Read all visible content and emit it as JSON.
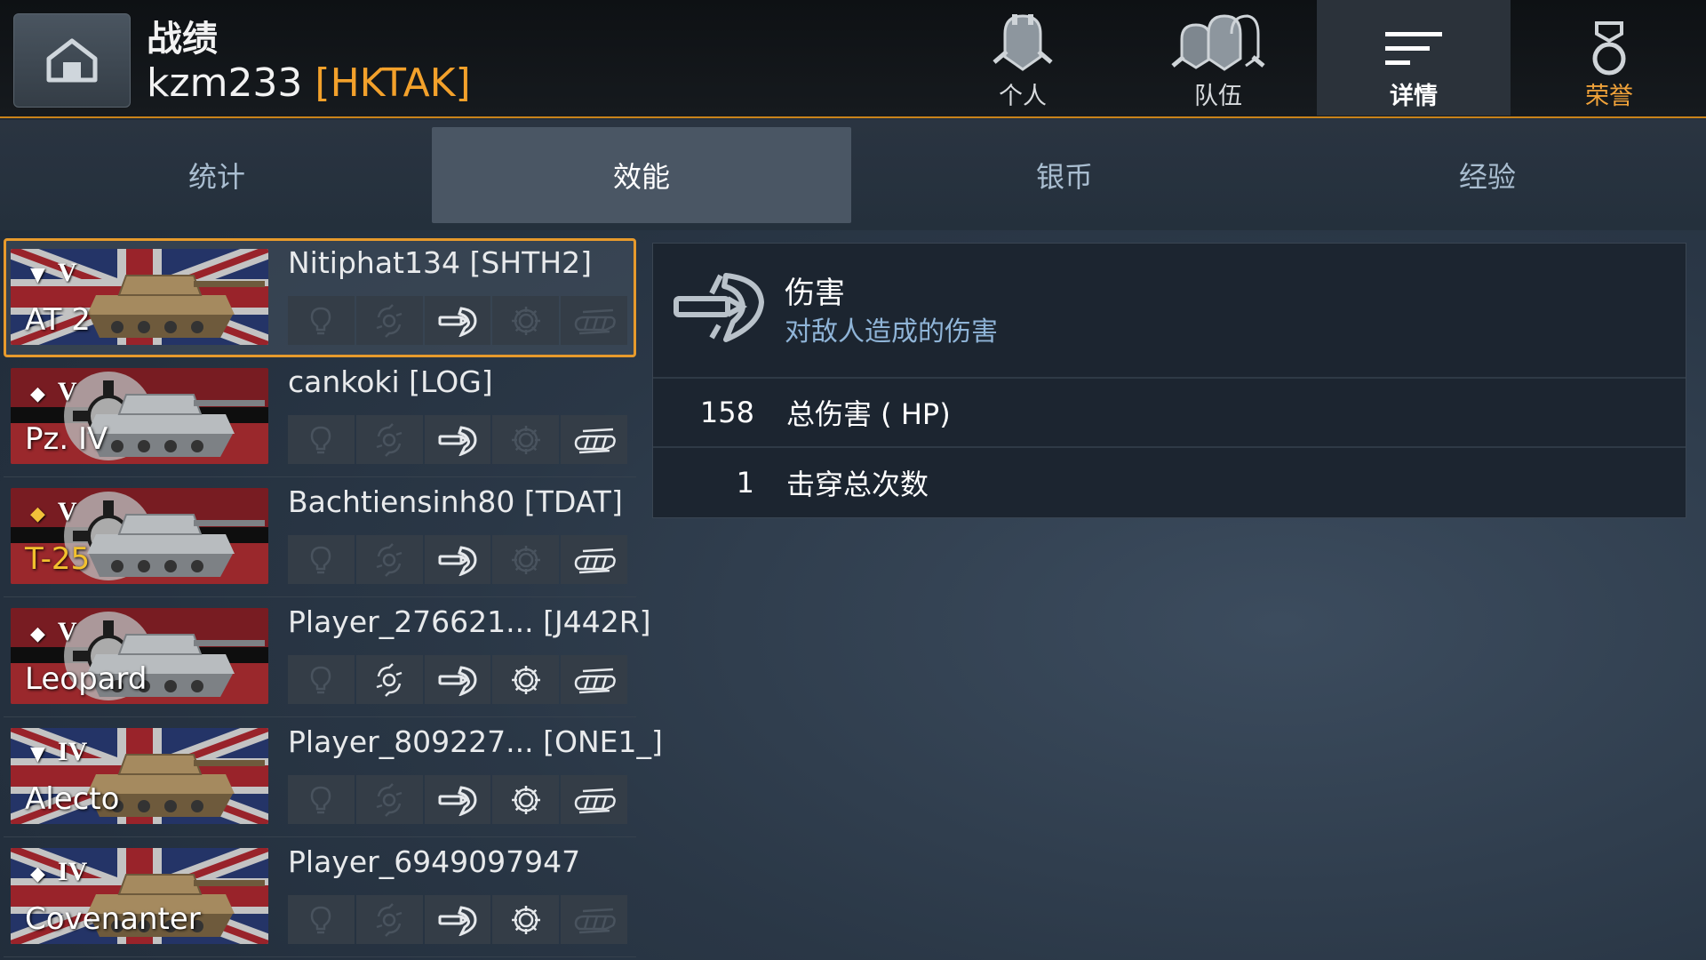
{
  "header": {
    "title": "战绩",
    "player": "kzm233",
    "clan": "[HKTAK]",
    "nav": [
      {
        "label": "个人",
        "icon": "player-helmet-icon"
      },
      {
        "label": "队伍",
        "icon": "team-helmets-icon"
      },
      {
        "label": "详情",
        "icon": "details-lines-icon",
        "active": true
      },
      {
        "label": "荣誉",
        "icon": "medal-ribbon-icon"
      }
    ]
  },
  "tabs": [
    {
      "label": "统计"
    },
    {
      "label": "效能",
      "active": true
    },
    {
      "label": "银币"
    },
    {
      "label": "经验"
    }
  ],
  "players": [
    {
      "name": "Nitiphat134 [SHTH2]",
      "tank": "AT 2",
      "tier": "V",
      "nation": "uk",
      "type_mark": "▼",
      "selected": true,
      "medals": [
        false,
        false,
        true,
        false,
        false
      ]
    },
    {
      "name": "cankoki [LOG]",
      "tank": "Pz. IV",
      "tier": "V",
      "nation": "germany",
      "type_mark": "◆",
      "medals": [
        false,
        false,
        true,
        false,
        true
      ]
    },
    {
      "name": "Bachtiensinh80 [TDAT]",
      "tank": "T-25",
      "tier": "V",
      "nation": "germany",
      "type_mark": "◆",
      "premium": true,
      "medals": [
        false,
        false,
        true,
        false,
        true
      ]
    },
    {
      "name": "Player_276621...  [J442R]",
      "tank": "Leopard",
      "tier": "V",
      "nation": "germany",
      "type_mark": "◆",
      "medals": [
        false,
        true,
        true,
        true,
        true
      ]
    },
    {
      "name": "Player_809227... [ONE1_]",
      "tank": "Alecto",
      "tier": "IV",
      "nation": "uk",
      "type_mark": "▼",
      "medals": [
        false,
        false,
        true,
        true,
        true
      ]
    },
    {
      "name": "Player_6949097947",
      "tank": "Covenanter",
      "tier": "IV",
      "nation": "uk",
      "type_mark": "◆",
      "medals": [
        false,
        false,
        true,
        true,
        false
      ]
    }
  ],
  "medal_icons": [
    "lightbulb-icon",
    "spotting-arrows-icon",
    "damage-shell-icon",
    "gear-icon",
    "tracks-assist-icon"
  ],
  "detail": {
    "icon": "damage-shell-icon",
    "title": "伤害",
    "description": "对敌人造成的伤害",
    "stats": [
      {
        "value": "158",
        "label": "总伤害 ( HP)"
      },
      {
        "value": "1",
        "label": "击穿总次数"
      }
    ]
  },
  "colors": {
    "accent_orange": "#e79a2c",
    "clan_orange": "#f3a12b",
    "premium_gold": "#f2c12e",
    "desc_blue": "#8fb4d7"
  }
}
